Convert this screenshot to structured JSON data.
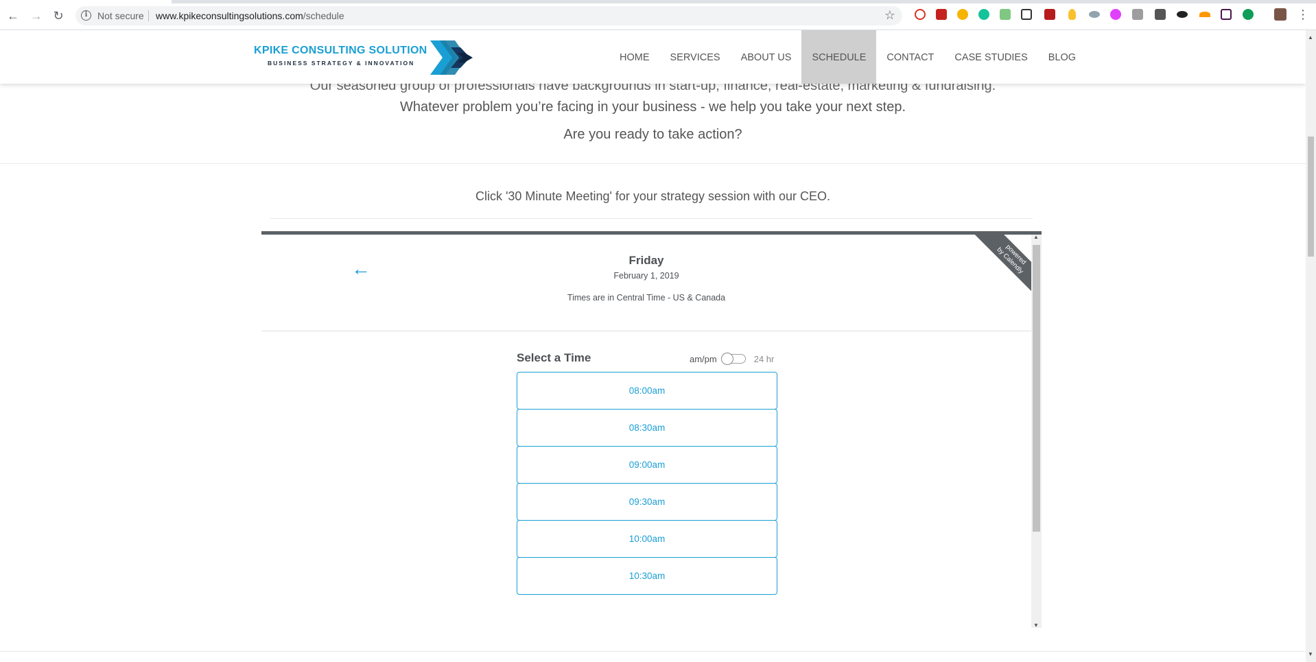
{
  "browser": {
    "security_label": "Not secure",
    "url_host": "www.kpikeconsultingsolutions.com",
    "url_path": "/schedule"
  },
  "site": {
    "logo_name": "KPIKE CONSULTING SOLUTION",
    "logo_tagline": "BUSINESS STRATEGY & INNOVATION",
    "nav": [
      "HOME",
      "SERVICES",
      "ABOUT US",
      "SCHEDULE",
      "CONTACT",
      "CASE STUDIES",
      "BLOG"
    ],
    "active_nav": "SCHEDULE"
  },
  "content": {
    "intro_line1": "Our seasoned group of professionals have backgrounds in start-up, finance, real-estate, marketing & fundraising.",
    "intro_line2": "Whatever problem you’re facing in your business - we help you take your next step.",
    "intro_question": "Are you ready to take action?",
    "cta": "Click '30 Minute Meeting' for your strategy session with our CEO."
  },
  "calendly": {
    "badge_line1": "powered",
    "badge_line2": "by Calendly",
    "day": "Friday",
    "date": "February 1, 2019",
    "timezone": "Times are in Central Time - US & Canada",
    "select_time": "Select a Time",
    "format_ampm": "am/pm",
    "format_24": "24 hr",
    "slots": [
      "08:00am",
      "08:30am",
      "09:00am",
      "09:30am",
      "10:00am",
      "10:30am"
    ]
  },
  "colors": {
    "brand_blue": "#1a9fd4",
    "active_nav_bg": "#cfcfcf"
  }
}
